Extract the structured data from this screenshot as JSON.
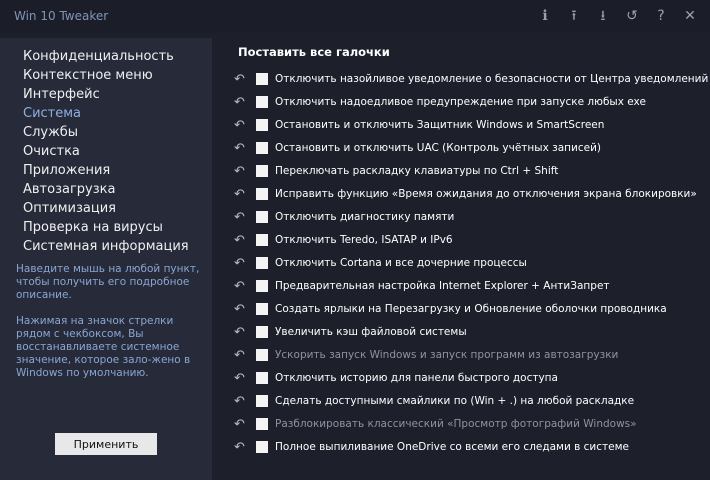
{
  "window": {
    "title": "Win 10 Tweaker"
  },
  "toolbar": [
    {
      "name": "info-icon",
      "glyph": "ℹ"
    },
    {
      "name": "export-icon",
      "glyph": "⭱"
    },
    {
      "name": "import-icon",
      "glyph": "⭳"
    },
    {
      "name": "restore-all-icon",
      "glyph": "↺"
    },
    {
      "name": "help-icon",
      "glyph": "?"
    },
    {
      "name": "close-icon",
      "glyph": "✕"
    }
  ],
  "sidebar": {
    "items": [
      "Конфиденциальность",
      "Контекстное меню",
      "Интерфейс",
      "Система",
      "Службы",
      "Очистка",
      "Приложения",
      "Автозагрузка",
      "Оптимизация",
      "Проверка на вирусы",
      "Системная информация"
    ],
    "active": "Система",
    "help1": "Наведите мышь на любой пункт, чтобы получить его подробное описание.",
    "help2": "Нажимая на значок стрелки рядом с чекбоксом, Вы восстанавливаете системное значение, которое зало-жено в Windows по умолчанию.",
    "apply_label": "Применить"
  },
  "main": {
    "check_all": "Поставить все галочки",
    "options": [
      {
        "label": "Отключить назойливое уведомление о безопасности от Центра уведомлений",
        "dim": false
      },
      {
        "label": "Отключить надоедливое предупреждение при запуске любых exe",
        "dim": false
      },
      {
        "label": "Остановить и отключить Защитник Windows и SmartScreen",
        "dim": false
      },
      {
        "label": "Остановить и отключить UAC (Контроль учётных записей)",
        "dim": false
      },
      {
        "label": "Переключать раскладку клавиатуры по Ctrl + Shift",
        "dim": false
      },
      {
        "label": "Исправить функцию «Время ожидания до отключения экрана блокировки»",
        "dim": false
      },
      {
        "label": "Отключить диагностику памяти",
        "dim": false
      },
      {
        "label": "Отключить Teredo, ISATAP и IPv6",
        "dim": false
      },
      {
        "label": "Отключить Cortana и все дочерние процессы",
        "dim": false
      },
      {
        "label": "Предварительная настройка Internet Explorer + АнтиЗапрет",
        "dim": false
      },
      {
        "label": "Создать ярлыки на Перезагрузку и Обновление оболочки проводника",
        "dim": false
      },
      {
        "label": "Увеличить кэш файловой системы",
        "dim": false
      },
      {
        "label": "Ускорить запуск Windows и запуск программ из автозагрузки",
        "dim": true
      },
      {
        "label": "Отключить историю для панели быстрого доступа",
        "dim": false
      },
      {
        "label": "Сделать доступными смайлики по (Win + .) на любой раскладке",
        "dim": false
      },
      {
        "label": "Разблокировать классический «Просмотр фотографий Windows»",
        "dim": true
      },
      {
        "label": "Полное выпиливание OneDrive со всеми его следами в системе",
        "dim": false
      }
    ]
  }
}
